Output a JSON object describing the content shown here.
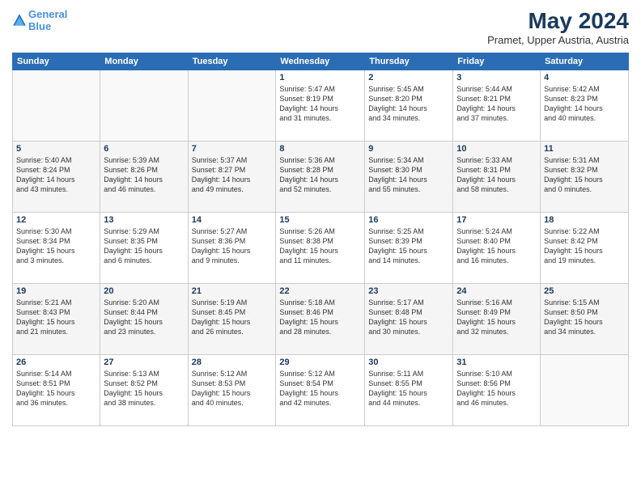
{
  "header": {
    "logo_general": "General",
    "logo_blue": "Blue",
    "month_title": "May 2024",
    "subtitle": "Pramet, Upper Austria, Austria"
  },
  "weekdays": [
    "Sunday",
    "Monday",
    "Tuesday",
    "Wednesday",
    "Thursday",
    "Friday",
    "Saturday"
  ],
  "weeks": [
    [
      {
        "day": "",
        "info": ""
      },
      {
        "day": "",
        "info": ""
      },
      {
        "day": "",
        "info": ""
      },
      {
        "day": "1",
        "info": "Sunrise: 5:47 AM\nSunset: 8:19 PM\nDaylight: 14 hours\nand 31 minutes."
      },
      {
        "day": "2",
        "info": "Sunrise: 5:45 AM\nSunset: 8:20 PM\nDaylight: 14 hours\nand 34 minutes."
      },
      {
        "day": "3",
        "info": "Sunrise: 5:44 AM\nSunset: 8:21 PM\nDaylight: 14 hours\nand 37 minutes."
      },
      {
        "day": "4",
        "info": "Sunrise: 5:42 AM\nSunset: 8:23 PM\nDaylight: 14 hours\nand 40 minutes."
      }
    ],
    [
      {
        "day": "5",
        "info": "Sunrise: 5:40 AM\nSunset: 8:24 PM\nDaylight: 14 hours\nand 43 minutes."
      },
      {
        "day": "6",
        "info": "Sunrise: 5:39 AM\nSunset: 8:26 PM\nDaylight: 14 hours\nand 46 minutes."
      },
      {
        "day": "7",
        "info": "Sunrise: 5:37 AM\nSunset: 8:27 PM\nDaylight: 14 hours\nand 49 minutes."
      },
      {
        "day": "8",
        "info": "Sunrise: 5:36 AM\nSunset: 8:28 PM\nDaylight: 14 hours\nand 52 minutes."
      },
      {
        "day": "9",
        "info": "Sunrise: 5:34 AM\nSunset: 8:30 PM\nDaylight: 14 hours\nand 55 minutes."
      },
      {
        "day": "10",
        "info": "Sunrise: 5:33 AM\nSunset: 8:31 PM\nDaylight: 14 hours\nand 58 minutes."
      },
      {
        "day": "11",
        "info": "Sunrise: 5:31 AM\nSunset: 8:32 PM\nDaylight: 15 hours\nand 0 minutes."
      }
    ],
    [
      {
        "day": "12",
        "info": "Sunrise: 5:30 AM\nSunset: 8:34 PM\nDaylight: 15 hours\nand 3 minutes."
      },
      {
        "day": "13",
        "info": "Sunrise: 5:29 AM\nSunset: 8:35 PM\nDaylight: 15 hours\nand 6 minutes."
      },
      {
        "day": "14",
        "info": "Sunrise: 5:27 AM\nSunset: 8:36 PM\nDaylight: 15 hours\nand 9 minutes."
      },
      {
        "day": "15",
        "info": "Sunrise: 5:26 AM\nSunset: 8:38 PM\nDaylight: 15 hours\nand 11 minutes."
      },
      {
        "day": "16",
        "info": "Sunrise: 5:25 AM\nSunset: 8:39 PM\nDaylight: 15 hours\nand 14 minutes."
      },
      {
        "day": "17",
        "info": "Sunrise: 5:24 AM\nSunset: 8:40 PM\nDaylight: 15 hours\nand 16 minutes."
      },
      {
        "day": "18",
        "info": "Sunrise: 5:22 AM\nSunset: 8:42 PM\nDaylight: 15 hours\nand 19 minutes."
      }
    ],
    [
      {
        "day": "19",
        "info": "Sunrise: 5:21 AM\nSunset: 8:43 PM\nDaylight: 15 hours\nand 21 minutes."
      },
      {
        "day": "20",
        "info": "Sunrise: 5:20 AM\nSunset: 8:44 PM\nDaylight: 15 hours\nand 23 minutes."
      },
      {
        "day": "21",
        "info": "Sunrise: 5:19 AM\nSunset: 8:45 PM\nDaylight: 15 hours\nand 26 minutes."
      },
      {
        "day": "22",
        "info": "Sunrise: 5:18 AM\nSunset: 8:46 PM\nDaylight: 15 hours\nand 28 minutes."
      },
      {
        "day": "23",
        "info": "Sunrise: 5:17 AM\nSunset: 8:48 PM\nDaylight: 15 hours\nand 30 minutes."
      },
      {
        "day": "24",
        "info": "Sunrise: 5:16 AM\nSunset: 8:49 PM\nDaylight: 15 hours\nand 32 minutes."
      },
      {
        "day": "25",
        "info": "Sunrise: 5:15 AM\nSunset: 8:50 PM\nDaylight: 15 hours\nand 34 minutes."
      }
    ],
    [
      {
        "day": "26",
        "info": "Sunrise: 5:14 AM\nSunset: 8:51 PM\nDaylight: 15 hours\nand 36 minutes."
      },
      {
        "day": "27",
        "info": "Sunrise: 5:13 AM\nSunset: 8:52 PM\nDaylight: 15 hours\nand 38 minutes."
      },
      {
        "day": "28",
        "info": "Sunrise: 5:12 AM\nSunset: 8:53 PM\nDaylight: 15 hours\nand 40 minutes."
      },
      {
        "day": "29",
        "info": "Sunrise: 5:12 AM\nSunset: 8:54 PM\nDaylight: 15 hours\nand 42 minutes."
      },
      {
        "day": "30",
        "info": "Sunrise: 5:11 AM\nSunset: 8:55 PM\nDaylight: 15 hours\nand 44 minutes."
      },
      {
        "day": "31",
        "info": "Sunrise: 5:10 AM\nSunset: 8:56 PM\nDaylight: 15 hours\nand 46 minutes."
      },
      {
        "day": "",
        "info": ""
      }
    ]
  ]
}
